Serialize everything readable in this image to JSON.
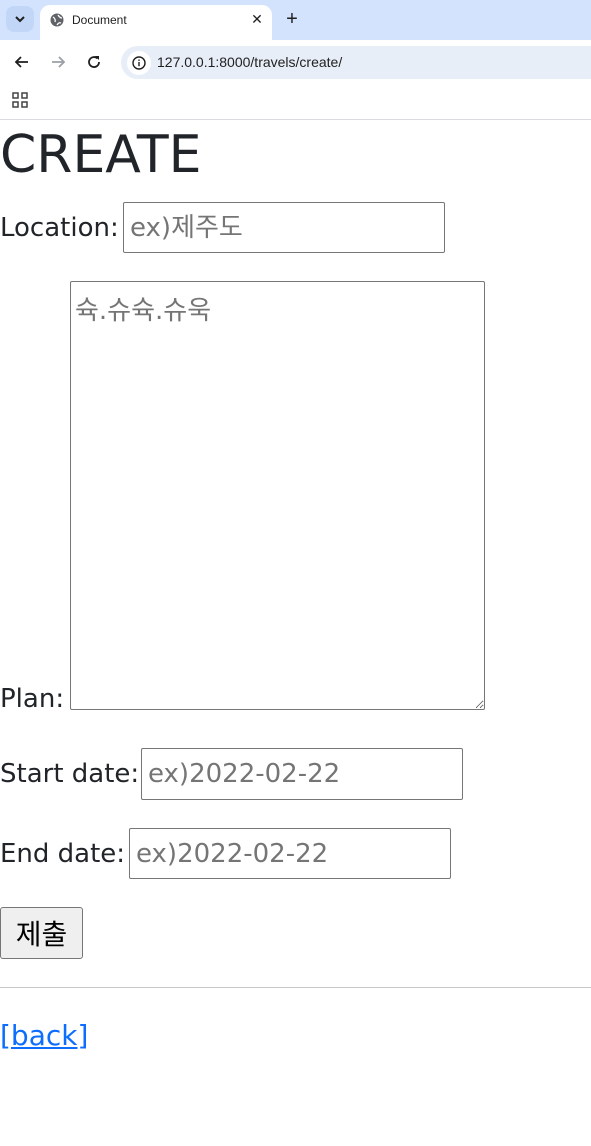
{
  "browser": {
    "tab_title": "Document",
    "tab_close_glyph": "✕",
    "new_tab_glyph": "+",
    "url": "127.0.0.1:8000/travels/create/",
    "icons": [
      "tab-search-icon",
      "globe-icon",
      "close-icon",
      "plus-icon",
      "back-arrow-icon",
      "forward-arrow-icon",
      "reload-icon",
      "site-info-icon",
      "apps-grid-icon"
    ]
  },
  "page": {
    "heading": "CREATE",
    "form": {
      "location_label": "Location:",
      "location_placeholder": "ex)제주도",
      "plan_label": "Plan:",
      "plan_placeholder": "슉.슈슉.슈욱",
      "start_label": "Start date:",
      "start_placeholder": "ex)2022-02-22",
      "end_label": "End date:",
      "end_placeholder": "ex)2022-02-22",
      "submit_label": "제출"
    },
    "back_link": "[back]"
  },
  "colors": {
    "tabstrip": "#d3e3fd",
    "omnibox": "#e8eef8",
    "text": "#212529",
    "placeholder": "#757575",
    "link": "#0d6efd"
  }
}
